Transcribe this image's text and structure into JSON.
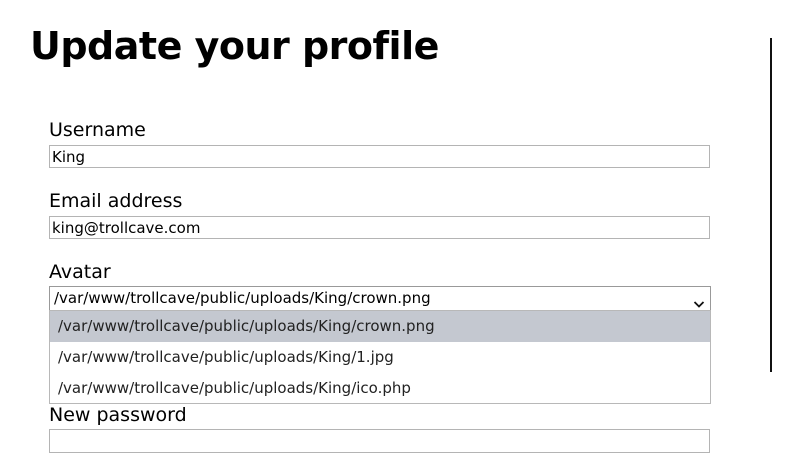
{
  "page": {
    "title": "Update your profile"
  },
  "form": {
    "username": {
      "label": "Username",
      "value": "King"
    },
    "email": {
      "label": "Email address",
      "value": "king@trollcave.com"
    },
    "avatar": {
      "label": "Avatar",
      "selected": "/var/www/trollcave/public/uploads/King/crown.png",
      "options": [
        "/var/www/trollcave/public/uploads/King/crown.png",
        "/var/www/trollcave/public/uploads/King/1.jpg",
        "/var/www/trollcave/public/uploads/King/ico.php"
      ],
      "highlighted_index": 0
    },
    "new_password": {
      "label": "New password",
      "value": ""
    }
  },
  "icons": {
    "avatar_select_arrow": "chevron-down-icon"
  },
  "colors": {
    "highlight": "#c4c8d0",
    "input_border": "#b4b4b4"
  }
}
